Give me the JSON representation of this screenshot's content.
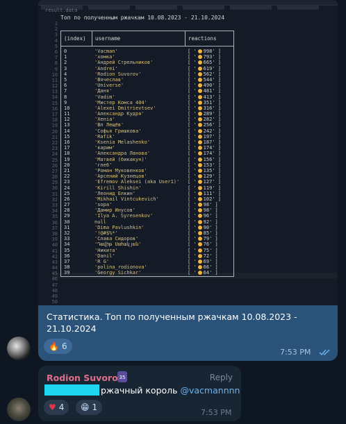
{
  "screenshot": {
    "file_label": "result.data",
    "title": "Топ по полученным ржачкам 10.08.2023 - 21.10.2024",
    "line_numbers": [
      "1",
      "2",
      "3",
      "4",
      "5",
      "6",
      "7",
      "8",
      "9",
      "10",
      "11",
      "12",
      "13",
      "14",
      "15",
      "16",
      "17",
      "18",
      "19",
      "20",
      "21",
      "22",
      "23",
      "24",
      "25",
      "26",
      "27",
      "28",
      "29",
      "30",
      "31",
      "32",
      "33",
      "34",
      "35",
      "36",
      "37",
      "38",
      "39",
      "40",
      "41",
      "42",
      "43",
      "44",
      "45",
      "46",
      "47",
      "48",
      "49",
      "50"
    ],
    "headers": {
      "index": "(index)",
      "username": "username",
      "reactions": "reactions"
    },
    "rows": [
      {
        "i": "0",
        "name": "'Vacman'",
        "count": "998"
      },
      {
        "i": "1",
        "name": "'хомка'",
        "count": "793"
      },
      {
        "i": "2",
        "name": "'Андрей Стрельников'",
        "count": "665"
      },
      {
        "i": "3",
        "name": "'Andrei'",
        "count": "619"
      },
      {
        "i": "4",
        "name": "'Rodion Suvorov'",
        "count": "562"
      },
      {
        "i": "5",
        "name": "'Вячеслав'",
        "count": "544"
      },
      {
        "i": "6",
        "name": "'Universe'",
        "count": "490"
      },
      {
        "i": "7",
        "name": "'Даня'",
        "count": "481"
      },
      {
        "i": "8",
        "name": "'Vadim'",
        "count": "413"
      },
      {
        "i": "9",
        "name": "'Мистер Комса 404'",
        "count": "351"
      },
      {
        "i": "10",
        "name": "'Alexei Dmitrievtsev'",
        "count": "316"
      },
      {
        "i": "11",
        "name": "'Александр Кудря'",
        "count": "289"
      },
      {
        "i": "12",
        "name": "'Xenia'",
        "count": "282"
      },
      {
        "i": "13",
        "name": "'Вл Лещёв'",
        "count": "256"
      },
      {
        "i": "14",
        "name": "'Софья Гришкова'",
        "count": "242"
      },
      {
        "i": "15",
        "name": "'Rafik'",
        "count": "197"
      },
      {
        "i": "16",
        "name": "'Ksenia Melashenko'",
        "count": "187"
      },
      {
        "i": "17",
        "name": "'карим'",
        "count": "174"
      },
      {
        "i": "18",
        "name": "'Александра Ланова'",
        "count": "174"
      },
      {
        "i": "19",
        "name": "'Матвей (бикакун)'",
        "count": "156"
      },
      {
        "i": "20",
        "name": "'гле6'",
        "count": "153"
      },
      {
        "i": "21",
        "name": "'Роман Муковенков'",
        "count": "135"
      },
      {
        "i": "22",
        "name": "'Арсений Кузнецов'",
        "count": "129"
      },
      {
        "i": "23",
        "name": "'Efremov Aleksei (aka User1)'",
        "count": "127"
      },
      {
        "i": "24",
        "name": "'Kirill Shishin'",
        "count": "119"
      },
      {
        "i": "25",
        "name": "'Леонид Елкин'",
        "count": "111"
      },
      {
        "i": "26",
        "name": "'Mikhail Vintcukevich'",
        "count": "102"
      },
      {
        "i": "27",
        "name": "'sopa'",
        "count": "98"
      },
      {
        "i": "28",
        "name": "'Дамир Инусов'",
        "count": "98"
      },
      {
        "i": "29",
        "name": "'Ilya A. Syresenkov'",
        "count": "96"
      },
      {
        "i": "30",
        "name": "null",
        "count": "92"
      },
      {
        "i": "31",
        "name": "'Dima Pavlushkin'",
        "count": "90"
      },
      {
        "i": "32",
        "name": "'!@#$%*'",
        "count": "85"
      },
      {
        "i": "33",
        "name": "'Слава Сидоров'",
        "count": "79"
      },
      {
        "i": "34",
        "name": "'Դավիթ Սահակյան'",
        "count": "76"
      },
      {
        "i": "35",
        "name": "'Никита'",
        "count": "75"
      },
      {
        "i": "36",
        "name": "'Danil'",
        "count": "72"
      },
      {
        "i": "37",
        "name": "'R G'",
        "count": "69"
      },
      {
        "i": "38",
        "name": "'polina_rodionova'",
        "count": "66"
      },
      {
        "i": "39",
        "name": "'Georgy Sichkar'",
        "count": "64"
      }
    ]
  },
  "caption": {
    "text": "Статистика. Топ по полученным ржачкам 10.08.2023 - 21.10.2024",
    "reaction_emoji": "🔥",
    "reaction_count": "6",
    "time": "7:53 PM",
    "read_icon": "double-check"
  },
  "reply": {
    "sender": "Rodion Suvorov",
    "badge": "35",
    "reply_label": "Reply",
    "text_main": "ржачный король ",
    "mention": "@vacmannnn",
    "reactions": [
      {
        "emoji": "♥",
        "count": "4"
      },
      {
        "emoji": "😁",
        "count": "1"
      }
    ],
    "time": "7:53 PM"
  }
}
